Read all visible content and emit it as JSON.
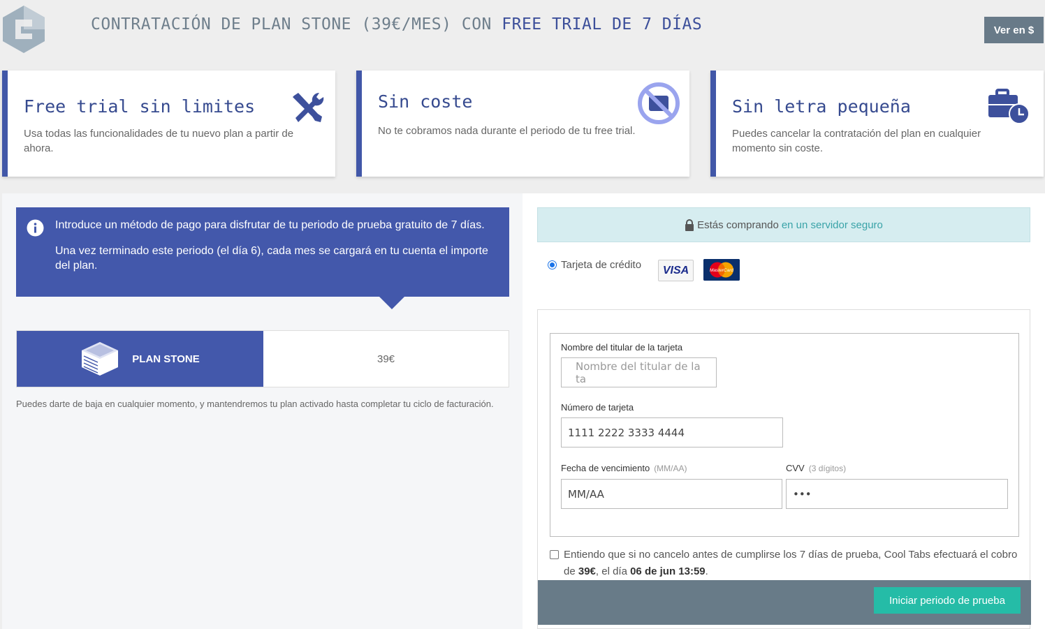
{
  "header": {
    "title_prefix": "CONTRATACIÓN DE PLAN STONE (39€/MES) CON",
    "title_highlight": "FREE TRIAL DE 7 DÍAS",
    "currency_button": "Ver en $"
  },
  "features": [
    {
      "title": "Free trial sin limites",
      "text": "Usa todas las funcionalidades de tu nuevo plan a partir de ahora.",
      "icon": "tools-icon"
    },
    {
      "title": "Sin coste",
      "text": "No te cobramos nada durante el periodo de tu free trial.",
      "icon": "no-wallet-icon"
    },
    {
      "title": "Sin letra pequeña",
      "text": "Puedes cancelar la contratación del plan en cualquier momento sin coste.",
      "icon": "briefcase-clock-icon"
    }
  ],
  "info": {
    "line1": "Introduce un método de pago para disfrutar de tu periodo de prueba gratuito de 7 días.",
    "line2": "Una vez terminado este periodo (el día 6), cada mes se cargará en tu cuenta el importe del plan."
  },
  "plan": {
    "name": "PLAN STONE",
    "price": "39€",
    "note": "Puedes darte de baja en cualquier momento, y mantendremos tu plan activado hasta completar tu ciclo de facturación."
  },
  "secure": {
    "text": "Estás comprando",
    "link": "en un servidor seguro"
  },
  "payment": {
    "method_label": "Tarjeta de crédito",
    "visa": "VISA",
    "mastercard": "MasterCard"
  },
  "form": {
    "holder_label": "Nombre del titular de la tarjeta",
    "holder_placeholder": "Nombre del titular de la ta",
    "card_label": "Número de tarjeta",
    "card_value": "1111 2222 3333 4444",
    "expiry_label": "Fecha de vencimiento",
    "expiry_hint": "(MM/AA)",
    "expiry_value": "MM/AA",
    "cvv_label": "CVV",
    "cvv_hint": "(3 dígitos)",
    "cvv_value": "•••"
  },
  "consent": {
    "text_before": "Entiendo que si no cancelo antes de cumplirse los 7 días de prueba, Cool Tabs efectuará el cobro de",
    "amount": "39€",
    "text_mid": ", el día",
    "date": "06 de jun 13:59",
    "text_end": "."
  },
  "submit_label": "Iniciar periodo de prueba"
}
